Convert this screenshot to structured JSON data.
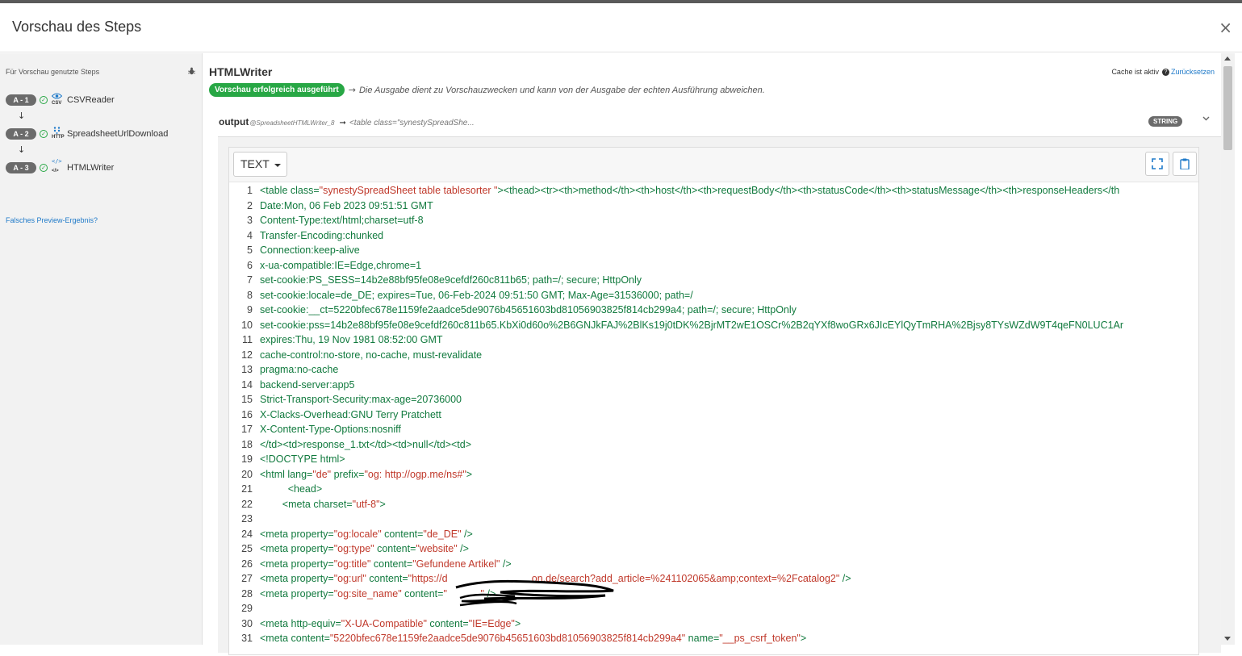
{
  "modal": {
    "title": "Vorschau des Steps",
    "close_label": "×"
  },
  "sidebar": {
    "heading": "Für Vorschau genutzte Steps",
    "steps": [
      {
        "badge": "A - 1",
        "icon": "eye-icon",
        "icon_sub": "CSV",
        "label": "CSVReader"
      },
      {
        "badge": "A - 2",
        "icon": "dots-icon",
        "icon_sub": "HTTP",
        "label": "SpreadsheetUrlDownload"
      },
      {
        "badge": "A - 3",
        "icon": "code-icon",
        "icon_sub": "</>",
        "label": "HTMLWriter"
      }
    ],
    "false_result_link": "Falsches Preview-Ergebnis?"
  },
  "main": {
    "title": "HTMLWriter",
    "cache_text": "Cache ist aktiv",
    "reset_link": "Zurücksetzen",
    "success_badge": "Vorschau erfolgreich ausgeführt",
    "success_note": "Die Ausgabe dient zu Vorschauzwecken und kann von der Ausgabe der echten Ausführung abweichen.",
    "output": {
      "name": "output",
      "ref": "@SpreadsheetHTMLWriter_8",
      "preview": "<table class=\"synestySpreadShe...",
      "type": "STRING"
    },
    "editor": {
      "format_select": "TEXT",
      "lines": [
        "<table class=\"synestySpreadSheet table tablesorter \"><thead><tr><th>method</th><th>host</th><th>requestBody</th><th>statusCode</th><th>statusMessage</th><th>responseHeaders</th",
        "Date:Mon, 06 Feb 2023 09:51:51 GMT",
        "Content-Type:text/html;charset=utf-8",
        "Transfer-Encoding:chunked",
        "Connection:keep-alive",
        "x-ua-compatible:IE=Edge,chrome=1",
        "set-cookie:PS_SESS=14b2e88bf95fe08e9cefdf260c811b65; path=/; secure; HttpOnly",
        "set-cookie:locale=de_DE; expires=Tue, 06-Feb-2024 09:51:50 GMT; Max-Age=31536000; path=/",
        "set-cookie:__ct=5220bfec678e1159fe2aadce5de9076b45651603bd81056903825f814cb299a4; path=/; secure; HttpOnly",
        "set-cookie:pss=14b2e88bf95fe08e9cefdf260c811b65.KbXi0d60o%2B6GNJkFAJ%2BlKs19j0tDK%2BjrMT2wE1OSCr%2B2qYXf8woGRx6JIcEYlQyTmRHA%2Bjsy8TYsWZdW9T4qeFN0LUC1Ar",
        "expires:Thu, 19 Nov 1981 08:52:00 GMT",
        "cache-control:no-store, no-cache, must-revalidate",
        "pragma:no-cache",
        "backend-server:app5",
        "Strict-Transport-Security:max-age=20736000",
        "X-Clacks-Overhead:GNU Terry Pratchett",
        "X-Content-Type-Options:nosniff",
        "</td><td>response_1.txt</td><td>null</td><td>",
        "<!DOCTYPE html>",
        "<html lang=\"de\" prefix=\"og: http://ogp.me/ns#\">",
        "          <head>",
        "        <meta charset=\"utf-8\">",
        "",
        "<meta property=\"og:locale\" content=\"de_DE\" />",
        "<meta property=\"og:type\" content=\"website\" />",
        "<meta property=\"og:title\" content=\"Gefundene Artikel\" />",
        "<meta property=\"og:url\" content=\"https://d                              on.de/search?add_article=%241102065&amp;context=%2Fcatalog2\" />",
        "<meta property=\"og:site_name\" content=\"            \" />",
        "",
        "<meta http-equiv=\"X-UA-Compatible\" content=\"IE=Edge\">",
        "<meta content=\"5220bfec678e1159fe2aadce5de9076b45651603bd81056903825f814cb299a4\" name=\"__ps_csrf_token\">"
      ]
    }
  }
}
